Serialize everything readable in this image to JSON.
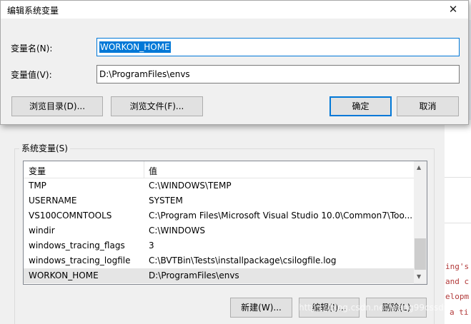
{
  "dialog": {
    "title": "编辑系统变量",
    "name_label": "变量名(N):",
    "name_value": "WORKON_HOME",
    "value_label": "变量值(V):",
    "value_value": "D:\\ProgramFiles\\envs",
    "browse_dir_label": "浏览目录(D)...",
    "browse_file_label": "浏览文件(F)...",
    "ok_label": "确定",
    "cancel_label": "取消",
    "close_glyph": "✕"
  },
  "parent": {
    "group_title": "系统变量(S)",
    "columns": [
      "变量",
      "值"
    ],
    "rows": [
      {
        "name": "TMP",
        "value": "C:\\WINDOWS\\TEMP"
      },
      {
        "name": "USERNAME",
        "value": "SYSTEM"
      },
      {
        "name": "VS100COMNTOOLS",
        "value": "C:\\Program Files\\Microsoft Visual Studio 10.0\\Common7\\Too..."
      },
      {
        "name": "windir",
        "value": "C:\\WINDOWS"
      },
      {
        "name": "windows_tracing_flags",
        "value": "3"
      },
      {
        "name": "windows_tracing_logfile",
        "value": "C:\\BVTBin\\Tests\\installpackage\\csilogfile.log"
      },
      {
        "name": "WORKON_HOME",
        "value": "D:\\ProgramFiles\\envs"
      }
    ],
    "new_label": "新建(W)...",
    "edit_label": "编辑(I)...",
    "delete_label": "删除(L)",
    "scroll_up_glyph": "▲",
    "scroll_down_glyph": "▼"
  },
  "background_code": [
    "ing's",
    "and c",
    "elopm",
    "a ti"
  ],
  "watermark": "https://blog.csdn.net/wang99cssdn"
}
